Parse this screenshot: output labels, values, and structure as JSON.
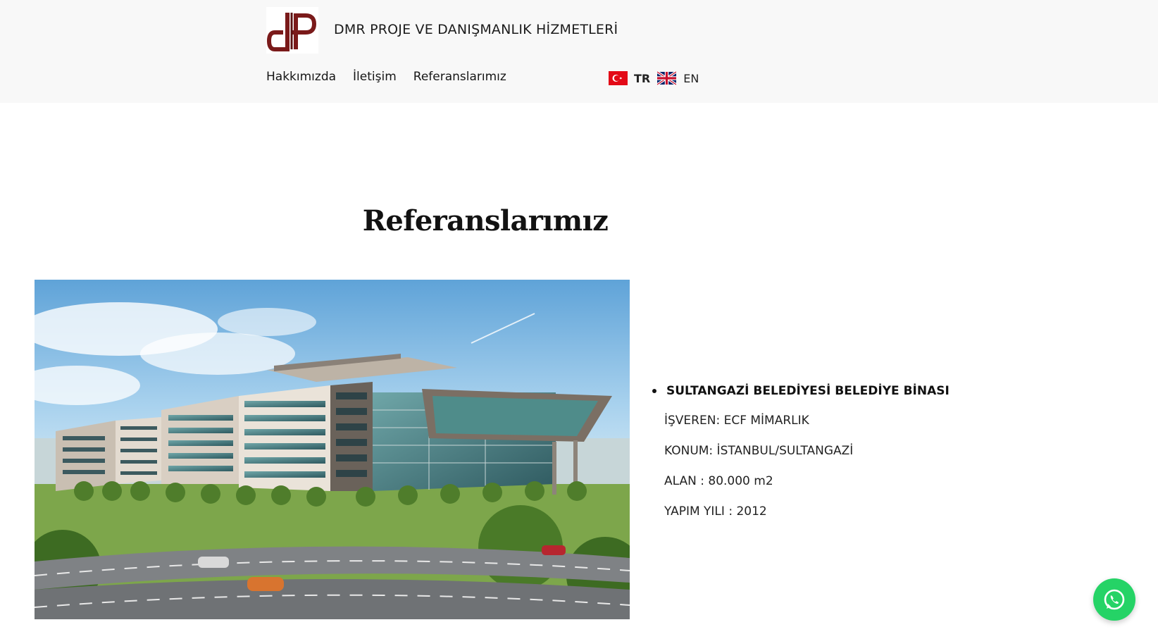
{
  "header": {
    "site_title": "DMR PROJE VE DANIŞMANLIK HİZMETLERİ",
    "nav": [
      {
        "label": "Hakkımızda"
      },
      {
        "label": "İletişim"
      },
      {
        "label": "Referanslarımız"
      }
    ],
    "languages": {
      "tr_label": "TR",
      "en_label": "EN",
      "active": "TR"
    }
  },
  "main": {
    "page_title": "Referanslarımız",
    "reference": {
      "title": "SULTANGAZİ BELEDİYESİ BELEDİYE BİNASI",
      "employer": "İŞVEREN: ECF MİMARLIK",
      "location": "KONUM: İSTANBUL/SULTANGAZİ",
      "area": "ALAN : 80.000 m2",
      "year": "YAPIM YILI : 2012"
    }
  },
  "colors": {
    "brand": "#7a1a1a",
    "header_bg": "#f8f8f8",
    "whatsapp": "#25d366"
  },
  "icons": {
    "logo": "dp-logo",
    "tr_flag": "turkey-flag-icon",
    "en_flag": "uk-flag-icon",
    "whatsapp": "whatsapp-icon"
  }
}
